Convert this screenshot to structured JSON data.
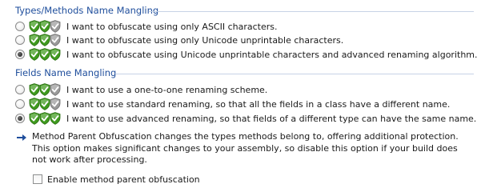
{
  "types_section": {
    "title": "Types/Methods Name Mangling",
    "options": [
      {
        "label": "I want to obfuscate using only ASCII characters.",
        "checked": false,
        "rating": 2
      },
      {
        "label": "I want to obfuscate using only Unicode unprintable characters.",
        "checked": false,
        "rating": 2
      },
      {
        "label": "I want to obfuscate using Unicode unprintable characters and advanced renaming algorithm.",
        "checked": true,
        "rating": 3
      }
    ]
  },
  "fields_section": {
    "title": "Fields Name Mangling",
    "options": [
      {
        "label": "I want to use a one-to-one renaming scheme.",
        "checked": false,
        "rating": 2
      },
      {
        "label": "I want to use standard renaming, so that all the fields in a class have a different name.",
        "checked": false,
        "rating": 2
      },
      {
        "label": "I want to use advanced renaming, so that fields of a different type can have the same name.",
        "checked": true,
        "rating": 3
      }
    ]
  },
  "info": {
    "text": "Method Parent Obfuscation changes the types methods belong to, offering additional protection. This option makes significant changes to your assembly, so disable this option if your build does not work after processing."
  },
  "parent_obfuscation": {
    "label": "Enable method parent obfuscation",
    "checked": false
  },
  "colors": {
    "section_title": "#1f4e9c",
    "rule": "#c7d3e6",
    "shield_active": "#3f9a1e",
    "shield_inactive": "#9a9a9a",
    "arrow": "#1f4e9c"
  }
}
